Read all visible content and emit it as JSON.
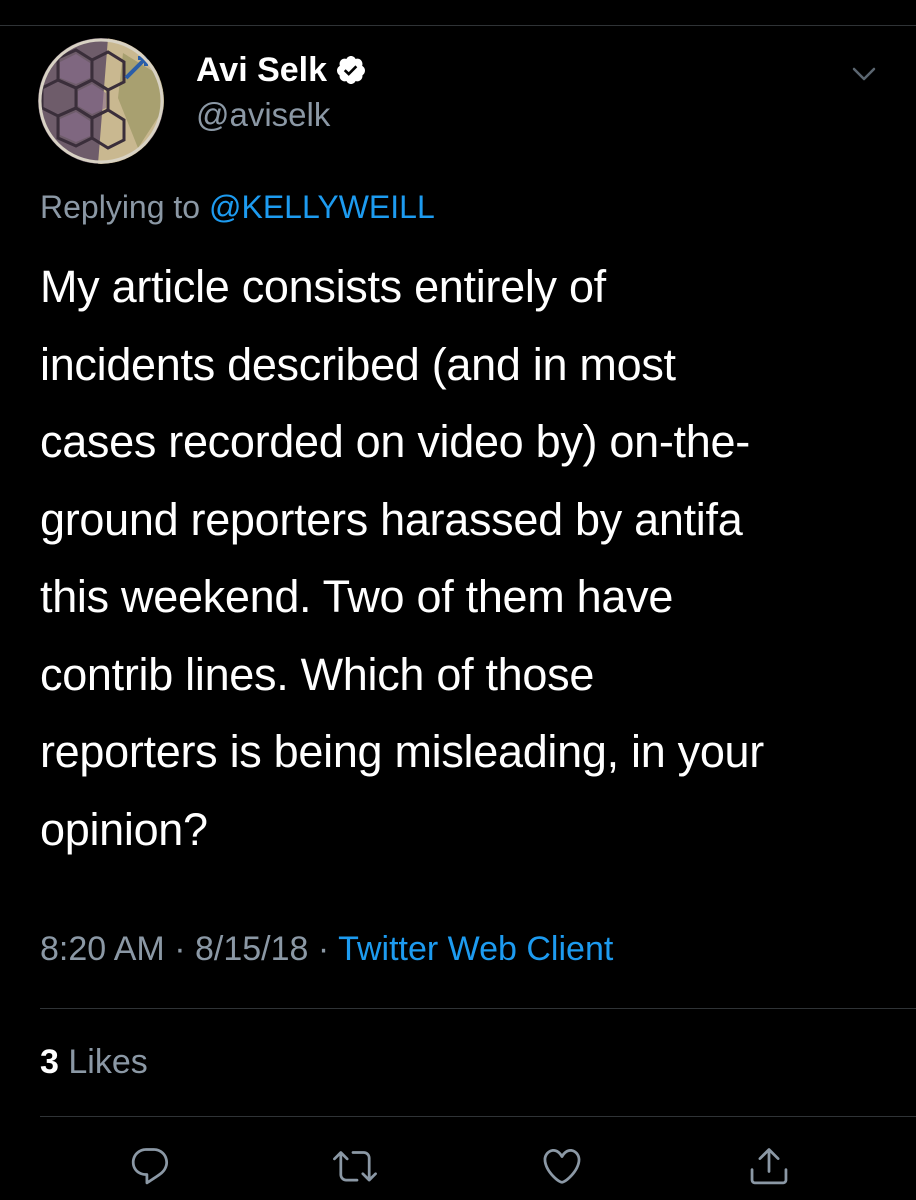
{
  "tweet": {
    "display_name": "Avi Selk",
    "handle": "@aviselk",
    "replying_prefix": "Replying to",
    "replying_to": "@KELLYWEILL",
    "body_lines": [
      "My article consists entirely of",
      "incidents described (and in most",
      "cases recorded on video by) on-the-",
      "ground reporters harassed by antifa",
      "this weekend. Two of them have",
      "contrib lines. Which of those",
      "reporters is being misleading, in your",
      "opinion?"
    ],
    "time": "8:20 AM",
    "date": "8/15/18",
    "separator": "·",
    "source": "Twitter Web Client",
    "likes_count": "3",
    "likes_label": "Likes"
  },
  "icons": {
    "verified": "verified-badge-icon",
    "menu": "chevron-down-icon",
    "reply": "reply-icon",
    "retweet": "retweet-icon",
    "like": "heart-icon",
    "share": "share-icon"
  },
  "colors": {
    "background": "#000000",
    "text": "#ffffff",
    "secondary_text": "#8b98a5",
    "link": "#1d9bf0",
    "divider": "#2f3336"
  }
}
